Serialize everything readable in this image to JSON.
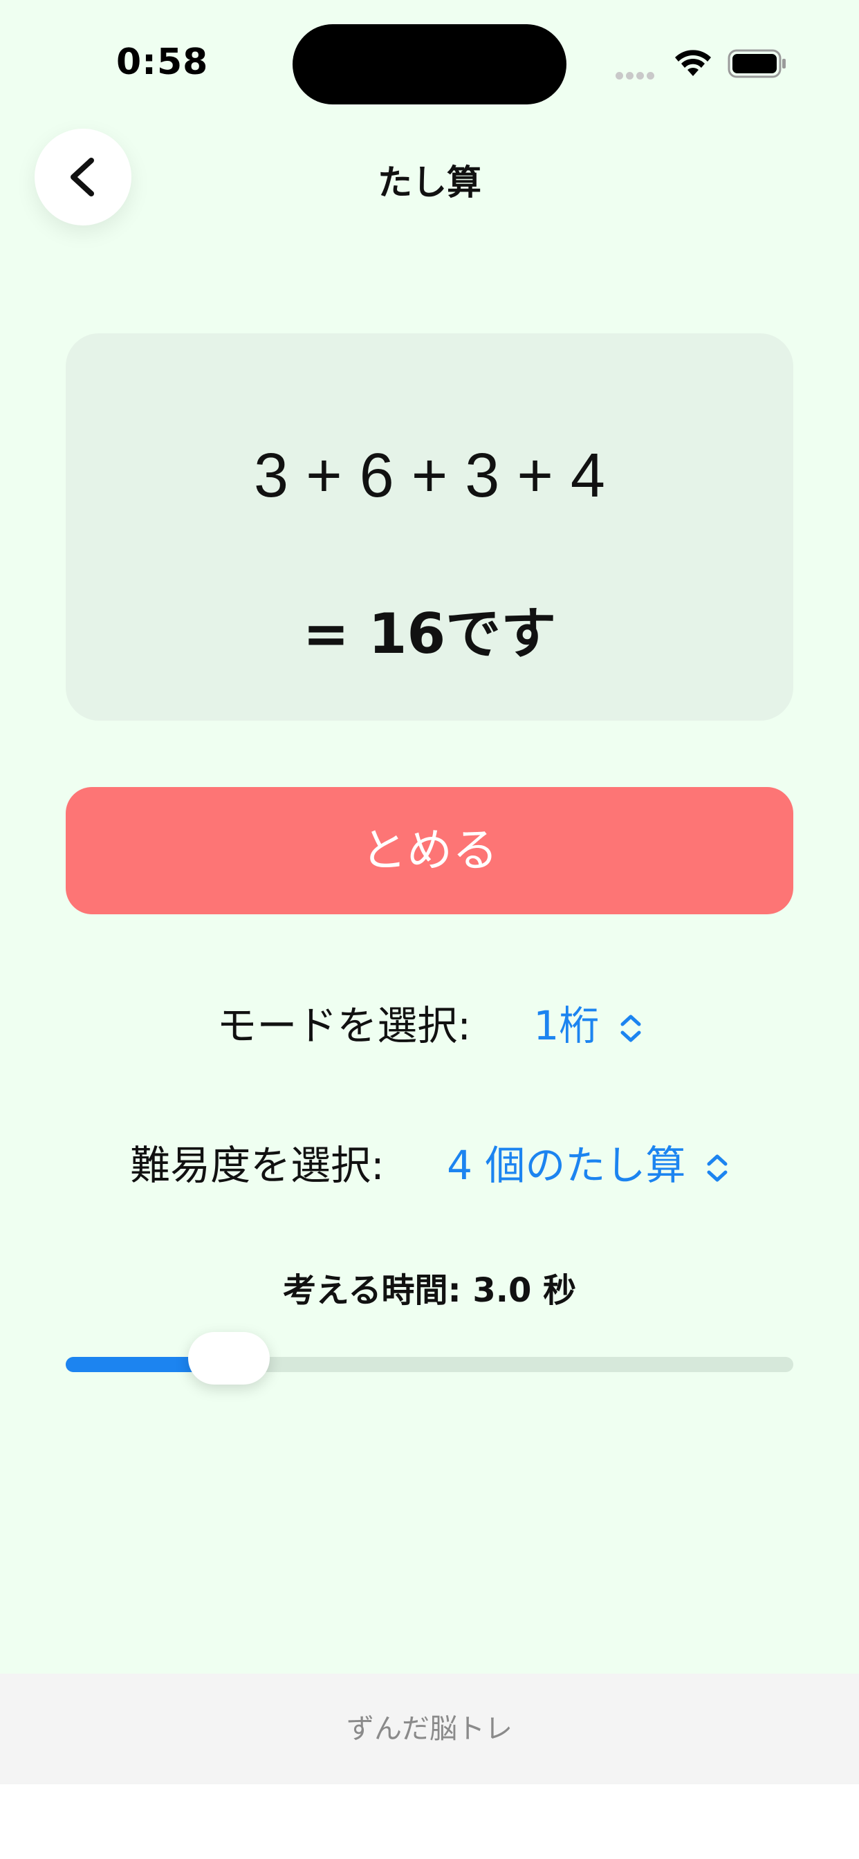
{
  "status_bar": {
    "time": "0:58"
  },
  "nav": {
    "title": "たし算",
    "back_icon": "chevron-left-icon"
  },
  "problem": {
    "expression": "3 + 6 + 3 + 4",
    "answer": "= 16です"
  },
  "stop_button": {
    "label": "とめる"
  },
  "mode_picker": {
    "label": "モードを選択:",
    "value": "1桁"
  },
  "difficulty_picker": {
    "label": "難易度を選択:",
    "value": "4 個のたし算"
  },
  "thinking_time": {
    "label": "考える時間: 3.0 秒",
    "slider_fraction": 0.19
  },
  "footer": {
    "app_name": "ずんだ脳トレ"
  },
  "colors": {
    "background": "#effff1",
    "card": "#e5f3e8",
    "stop_button": "#fd7575",
    "accent": "#1c84f0",
    "footer": "#f4f4f4"
  }
}
